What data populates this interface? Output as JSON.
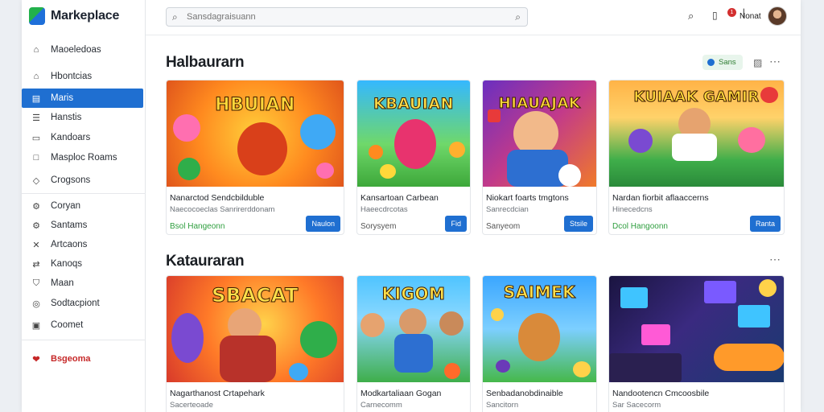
{
  "app": {
    "name": "Markeplace"
  },
  "sidebar": {
    "items": [
      {
        "label": "Maoeledoas",
        "icon": "home-icon"
      },
      {
        "label": "Hbontcias",
        "icon": "home-icon"
      },
      {
        "label": "Maris",
        "icon": "grid-icon",
        "active": true
      },
      {
        "label": "Hanstis",
        "icon": "list-icon"
      },
      {
        "label": "Kandoars",
        "icon": "chat-icon"
      },
      {
        "label": "Masploc Roams",
        "icon": "square-icon"
      },
      {
        "label": "Crogsons",
        "icon": "tag-icon"
      },
      {
        "label": "Coryan",
        "icon": "gear-icon"
      },
      {
        "label": "Santams",
        "icon": "settings-icon"
      },
      {
        "label": "Artcaons",
        "icon": "tools-icon"
      },
      {
        "label": "Kanoqs",
        "icon": "share-icon"
      },
      {
        "label": "Maan",
        "icon": "shield-icon"
      },
      {
        "label": "Sodtacpiont",
        "icon": "support-icon"
      },
      {
        "label": "Coomet",
        "icon": "folder-icon"
      },
      {
        "label": "Bsgeoma",
        "icon": "heart-icon",
        "danger": true
      }
    ]
  },
  "header": {
    "search_placeholder": "Sansdagraisuann",
    "notification_count": "1",
    "user_name": "Nonat"
  },
  "sections": [
    {
      "title": "Halbaurarn",
      "status_label": "Sans",
      "cards": [
        {
          "art_title": "HBUIAN",
          "name": "Nanarctod Sendcbilduble",
          "sub": "Naecocoeclas Sanrirerddonam",
          "price": "Bsol Hangeonn",
          "price_green": true,
          "button": "Naulon"
        },
        {
          "art_title": "KBAUIAN",
          "name": "Kansartoan Carbean",
          "sub": "Haeecdrcotas",
          "price": "Sorysyem",
          "price_green": false,
          "button": "Fid"
        },
        {
          "art_title": "HIAUAJAK",
          "name": "Niokart foarts tmgtons",
          "sub": "Sanrecdcian",
          "price": "Sanyeom",
          "price_green": false,
          "button": "Stsile"
        },
        {
          "art_title": "KUIAAK GAMIR",
          "name": "Nardan fiorbit aflaaccerns",
          "sub": "Hinecedcns",
          "price": "Dcol Hangoonn",
          "price_green": true,
          "button": "Ranta"
        }
      ]
    },
    {
      "title": "Katauraran",
      "cards": [
        {
          "art_title": "SBACAT",
          "name": "Nagarthanost Crtapehark",
          "sub": "Sacerteoade",
          "price": "",
          "price_green": false,
          "button": ""
        },
        {
          "art_title": "KIGOM",
          "name": "Modkartaliaan Gogan",
          "sub": "Carnecomm",
          "price": "",
          "price_green": false,
          "button": ""
        },
        {
          "art_title": "SAIMEK",
          "name": "Senbadanobdinaible",
          "sub": "Sancitorn",
          "price": "",
          "price_green": false,
          "button": ""
        },
        {
          "art_title": "",
          "name": "Nandootencn Cmcoosbile",
          "sub": "Sar Sacecorm",
          "price": "",
          "price_green": false,
          "button": ""
        }
      ]
    }
  ],
  "colors": {
    "accent": "#1f6fd1",
    "green": "#2e9e3e",
    "danger": "#c62828"
  }
}
